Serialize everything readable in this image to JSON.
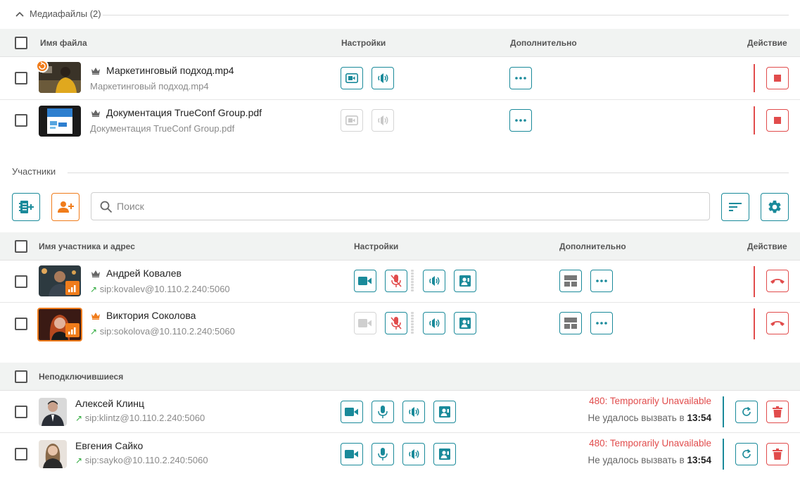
{
  "media": {
    "title": "Медиафайлы (2)",
    "columns": {
      "name": "Имя файла",
      "settings": "Настройки",
      "extra": "Дополнительно",
      "action": "Действие"
    },
    "files": [
      {
        "name": "Маркетинговый подход.mp4",
        "sub": "Маркетинговый подход.mp4",
        "enabled": true
      },
      {
        "name": "Документация TrueConf Group.pdf",
        "sub": "Документация TrueConf Group.pdf",
        "enabled": false
      }
    ]
  },
  "participants": {
    "title": "Участники",
    "search_placeholder": "Поиск",
    "columns": {
      "name": "Имя участника и адрес",
      "settings": "Настройки",
      "extra": "Дополнительно",
      "action": "Действие"
    },
    "items": [
      {
        "name": "Андрей Ковалев",
        "address": "sip:kovalev@10.110.2.240:5060",
        "video_enabled": true
      },
      {
        "name": "Виктория Соколова",
        "address": "sip:sokolova@10.110.2.240:5060",
        "video_enabled": false
      }
    ]
  },
  "disconnected": {
    "title": "Неподключившиеся",
    "items": [
      {
        "name": "Алексей Клинц",
        "address": "sip:klintz@10.110.2.240:5060",
        "error": "480: Temporarily Unavailable",
        "fail_text": "Не удалось вызвать в",
        "time": "13:54"
      },
      {
        "name": "Евгения Сайко",
        "address": "sip:sayko@10.110.2.240:5060",
        "error": "480: Temporarily Unavailable",
        "fail_text": "Не удалось вызвать в",
        "time": "13:54"
      }
    ]
  },
  "colors": {
    "teal": "#1a8a9a",
    "red": "#e14c4c",
    "orange": "#f07c1b",
    "green": "#2eaa3c"
  }
}
